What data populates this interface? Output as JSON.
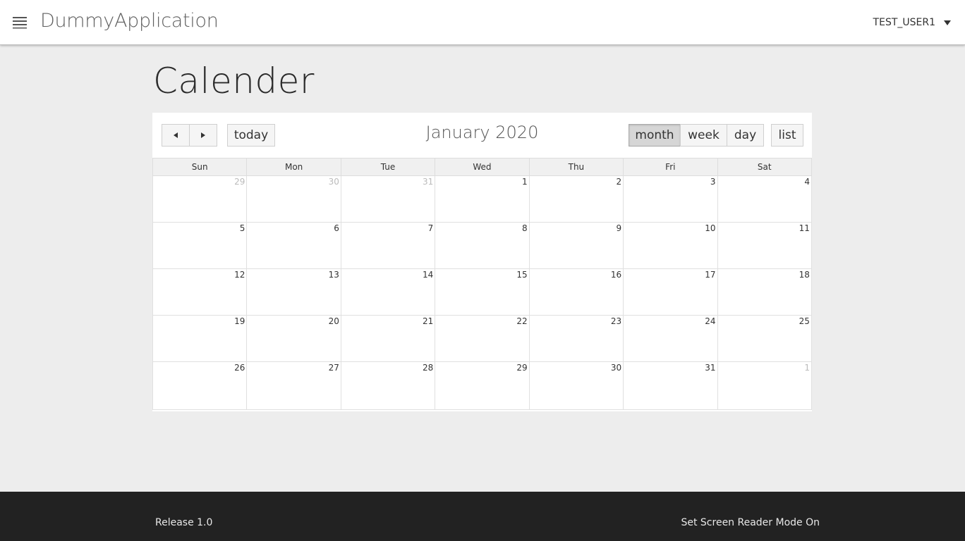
{
  "header": {
    "menu_icon": "hamburger-icon",
    "app_title": "DummyApplication",
    "user_name": "TEST_USER1",
    "user_caret_icon": "caret-down-icon"
  },
  "page": {
    "title": "Calender"
  },
  "calendar": {
    "prev_icon": "prev-arrow-icon",
    "next_icon": "next-arrow-icon",
    "today_label": "today",
    "title": "January 2020",
    "views": [
      {
        "label": "month",
        "active": true
      },
      {
        "label": "week",
        "active": false
      },
      {
        "label": "day",
        "active": false
      },
      {
        "label": "list",
        "active": false
      }
    ],
    "day_names": [
      "Sun",
      "Mon",
      "Tue",
      "Wed",
      "Thu",
      "Fri",
      "Sat"
    ],
    "weeks": [
      [
        {
          "d": "29",
          "other": true
        },
        {
          "d": "30",
          "other": true
        },
        {
          "d": "31",
          "other": true
        },
        {
          "d": "1"
        },
        {
          "d": "2"
        },
        {
          "d": "3"
        },
        {
          "d": "4"
        }
      ],
      [
        {
          "d": "5"
        },
        {
          "d": "6"
        },
        {
          "d": "7"
        },
        {
          "d": "8"
        },
        {
          "d": "9"
        },
        {
          "d": "10"
        },
        {
          "d": "11"
        }
      ],
      [
        {
          "d": "12"
        },
        {
          "d": "13"
        },
        {
          "d": "14"
        },
        {
          "d": "15"
        },
        {
          "d": "16"
        },
        {
          "d": "17"
        },
        {
          "d": "18"
        }
      ],
      [
        {
          "d": "19"
        },
        {
          "d": "20"
        },
        {
          "d": "21"
        },
        {
          "d": "22"
        },
        {
          "d": "23"
        },
        {
          "d": "24"
        },
        {
          "d": "25"
        }
      ],
      [
        {
          "d": "26"
        },
        {
          "d": "27"
        },
        {
          "d": "28"
        },
        {
          "d": "29"
        },
        {
          "d": "30"
        },
        {
          "d": "31"
        },
        {
          "d": "1",
          "other": true
        }
      ]
    ]
  },
  "footer": {
    "release": "Release 1.0",
    "screen_reader": "Set Screen Reader Mode On"
  }
}
